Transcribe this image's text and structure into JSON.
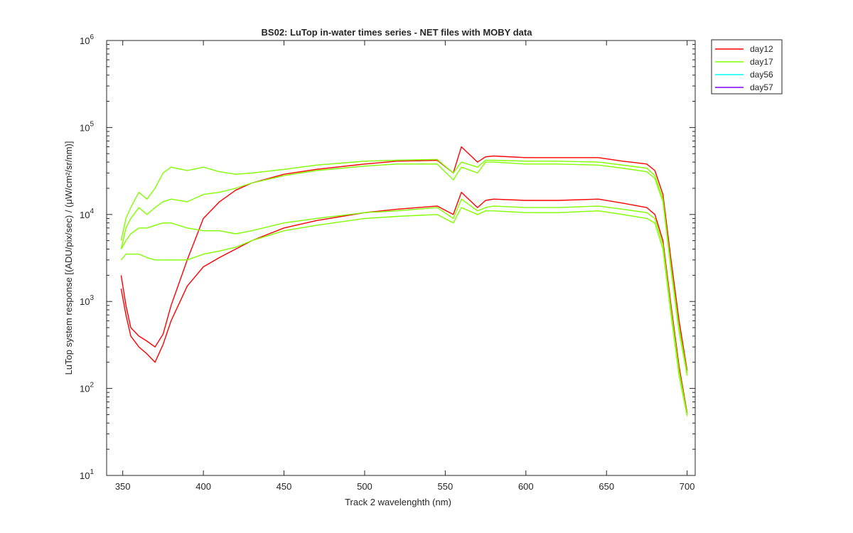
{
  "chart_data": {
    "type": "line",
    "title": "BS02: LuTop in-water times series - NET files with MOBY data",
    "xlabel": "Track 2 wavelenghth (nm)",
    "ylabel": "LuTop system response [(ADU/pix/sec) / (μW/cm²/sr/nm)]",
    "xlim": [
      340,
      705
    ],
    "ylim": [
      10,
      1000000
    ],
    "yscale": "log",
    "grid": false,
    "legend_position": "outside top-right",
    "x_ticks": [
      350,
      400,
      450,
      500,
      550,
      600,
      650,
      700
    ],
    "y_ticks": [
      {
        "value": 10,
        "base": "10",
        "exp": "1"
      },
      {
        "value": 100,
        "base": "10",
        "exp": "2"
      },
      {
        "value": 1000,
        "base": "10",
        "exp": "3"
      },
      {
        "value": 10000,
        "base": "10",
        "exp": "4"
      },
      {
        "value": 100000,
        "base": "10",
        "exp": "5"
      },
      {
        "value": 1000000,
        "base": "10",
        "exp": "6"
      }
    ],
    "legend": [
      {
        "name": "day12",
        "color": "#ff0000"
      },
      {
        "name": "day17",
        "color": "#80ff00"
      },
      {
        "name": "day56",
        "color": "#00ffff"
      },
      {
        "name": "day57",
        "color": "#8000ff"
      }
    ],
    "series": [
      {
        "name": "day12",
        "color": "#ff0000",
        "x": [
          349,
          352,
          355,
          360,
          365,
          370,
          375,
          380,
          390,
          400,
          410,
          420,
          430,
          450,
          470,
          500,
          520,
          545,
          555,
          560,
          570,
          575,
          580,
          600,
          620,
          645,
          660,
          675,
          680,
          685,
          690,
          695,
          700
        ],
        "y": [
          2000,
          900,
          500,
          400,
          350,
          300,
          420,
          900,
          3000,
          9000,
          14000,
          19000,
          23000,
          29000,
          33000,
          38000,
          41000,
          42000,
          30000,
          60000,
          40000,
          46000,
          47000,
          45000,
          45000,
          45000,
          41000,
          38000,
          32000,
          17000,
          3000,
          600,
          160
        ]
      },
      {
        "name": "day12",
        "color": "#ff0000",
        "x": [
          349,
          352,
          355,
          360,
          365,
          370,
          375,
          380,
          390,
          400,
          410,
          420,
          430,
          450,
          470,
          500,
          520,
          545,
          555,
          560,
          570,
          575,
          580,
          600,
          620,
          645,
          660,
          675,
          680,
          685,
          690,
          695,
          700
        ],
        "y": [
          1400,
          700,
          400,
          300,
          250,
          200,
          320,
          600,
          1500,
          2500,
          3200,
          4000,
          5000,
          7000,
          8500,
          10500,
          11500,
          12500,
          10000,
          18000,
          12000,
          14500,
          15000,
          14500,
          14500,
          15000,
          13500,
          12000,
          10000,
          5000,
          900,
          180,
          52
        ]
      },
      {
        "name": "day17",
        "color": "#80ff00",
        "x": [
          349,
          352,
          355,
          360,
          365,
          370,
          375,
          380,
          390,
          400,
          410,
          420,
          430,
          450,
          470,
          500,
          520,
          545,
          555,
          560,
          570,
          575,
          580,
          600,
          620,
          645,
          660,
          675,
          680,
          685,
          690,
          695,
          700
        ],
        "y": [
          5000,
          9000,
          12000,
          18000,
          15000,
          20000,
          30000,
          35000,
          32000,
          35000,
          31000,
          29000,
          30000,
          33000,
          37000,
          41000,
          42000,
          43000,
          30000,
          40000,
          35000,
          42000,
          42000,
          41000,
          41000,
          40000,
          37000,
          34000,
          28000,
          15000,
          2500,
          500,
          150
        ]
      },
      {
        "name": "day17",
        "color": "#80ff00",
        "x": [
          349,
          352,
          355,
          360,
          365,
          370,
          375,
          380,
          390,
          400,
          410,
          420,
          430,
          450,
          470,
          500,
          520,
          545,
          555,
          560,
          570,
          575,
          580,
          600,
          620,
          645,
          660,
          675,
          680,
          685,
          690,
          695,
          700
        ],
        "y": [
          4000,
          7000,
          9000,
          12000,
          10000,
          12000,
          14000,
          15000,
          14000,
          17000,
          18000,
          20000,
          23000,
          28000,
          32000,
          36000,
          38000,
          38000,
          25000,
          35000,
          30000,
          40000,
          40000,
          38000,
          38000,
          37000,
          34000,
          31000,
          26000,
          14000,
          2300,
          450,
          140
        ]
      },
      {
        "name": "day17",
        "color": "#80ff00",
        "x": [
          349,
          352,
          355,
          360,
          365,
          370,
          375,
          380,
          390,
          400,
          410,
          420,
          430,
          450,
          470,
          500,
          520,
          545,
          555,
          560,
          570,
          575,
          580,
          600,
          620,
          645,
          660,
          675,
          680,
          685,
          690,
          695,
          700
        ],
        "y": [
          4000,
          5000,
          6000,
          7000,
          7000,
          7500,
          8000,
          8000,
          7000,
          6500,
          6500,
          6000,
          6500,
          8000,
          9000,
          10500,
          11000,
          12000,
          9000,
          15000,
          11000,
          12000,
          12500,
          12000,
          12000,
          12500,
          11500,
          10500,
          9000,
          4500,
          800,
          160,
          50
        ]
      },
      {
        "name": "day17",
        "color": "#80ff00",
        "x": [
          349,
          352,
          355,
          360,
          365,
          370,
          375,
          380,
          390,
          400,
          410,
          420,
          430,
          450,
          470,
          500,
          520,
          545,
          555,
          560,
          570,
          575,
          580,
          600,
          620,
          645,
          660,
          675,
          680,
          685,
          690,
          695,
          700
        ],
        "y": [
          3000,
          3500,
          3500,
          3500,
          3200,
          3000,
          3000,
          3000,
          3000,
          3500,
          3800,
          4200,
          5000,
          6500,
          7500,
          9000,
          9500,
          10000,
          8000,
          12000,
          10000,
          11000,
          11000,
          10500,
          10500,
          11000,
          10000,
          9000,
          8000,
          4000,
          700,
          140,
          48
        ]
      }
    ]
  }
}
